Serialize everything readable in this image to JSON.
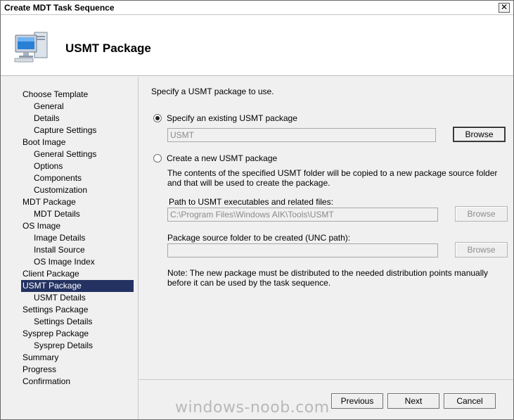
{
  "window": {
    "title": "Create MDT Task Sequence",
    "close_glyph": "✕"
  },
  "header": {
    "title": "USMT Package",
    "icon": "computer-icon"
  },
  "sidebar": {
    "items": [
      {
        "label": "Choose Template",
        "level": 0
      },
      {
        "label": "General",
        "level": 1
      },
      {
        "label": "Details",
        "level": 1
      },
      {
        "label": "Capture Settings",
        "level": 1
      },
      {
        "label": "Boot Image",
        "level": 0
      },
      {
        "label": "General Settings",
        "level": 1
      },
      {
        "label": "Options",
        "level": 1
      },
      {
        "label": "Components",
        "level": 1
      },
      {
        "label": "Customization",
        "level": 1
      },
      {
        "label": "MDT Package",
        "level": 0
      },
      {
        "label": "MDT Details",
        "level": 1
      },
      {
        "label": "OS Image",
        "level": 0
      },
      {
        "label": "Image Details",
        "level": 1
      },
      {
        "label": "Install Source",
        "level": 1
      },
      {
        "label": "OS Image Index",
        "level": 1
      },
      {
        "label": "Client Package",
        "level": 0
      },
      {
        "label": "USMT Package",
        "level": 0,
        "selected": true
      },
      {
        "label": "USMT Details",
        "level": 1
      },
      {
        "label": "Settings Package",
        "level": 0
      },
      {
        "label": "Settings Details",
        "level": 1
      },
      {
        "label": "Sysprep Package",
        "level": 0
      },
      {
        "label": "Sysprep Details",
        "level": 1
      },
      {
        "label": "Summary",
        "level": 0
      },
      {
        "label": "Progress",
        "level": 0
      },
      {
        "label": "Confirmation",
        "level": 0
      }
    ]
  },
  "main": {
    "instruction": "Specify a USMT package to use.",
    "existing_option": {
      "label": "Specify an existing USMT package",
      "selected": true
    },
    "existing_value": "USMT",
    "browse_label": "Browse",
    "new_option": {
      "label": "Create a new USMT package",
      "selected": false
    },
    "new_description": "The contents of the specified USMT folder will be copied to a new package source folder and that will be used to create the package.",
    "path_label": "Path to USMT executables and related files:",
    "path_value": "C:\\Program Files\\Windows AIK\\Tools\\USMT",
    "source_label": "Package source folder to be created (UNC path):",
    "source_value": "",
    "note": "Note: The new package must be distributed to the needed distribution points manually before it can be used by the task sequence."
  },
  "footer": {
    "previous_label": "Previous",
    "next_label": "Next",
    "cancel_label": "Cancel"
  },
  "watermark": "windows-noob.com"
}
